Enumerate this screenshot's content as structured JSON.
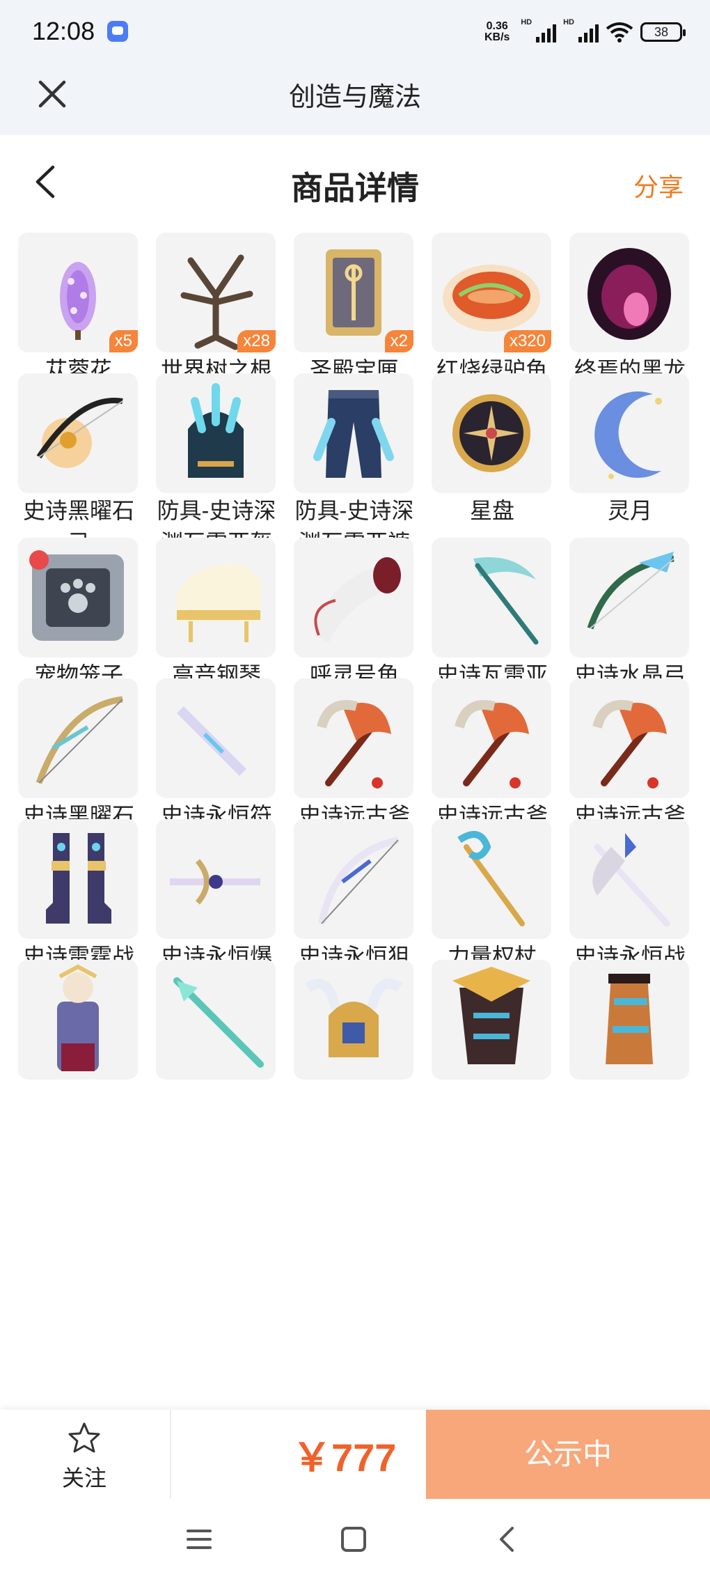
{
  "status": {
    "time": "12:08",
    "speed_top": "0.36",
    "speed_bottom": "KB/s",
    "battery": "38"
  },
  "app": {
    "title": "创造与魔法"
  },
  "header": {
    "title": "商品详情",
    "share": "分享"
  },
  "items": [
    {
      "name": "苁蓉花",
      "badge": "x5",
      "icon": "flower-cone-icon"
    },
    {
      "name": "世界树之根",
      "badge": "x28",
      "icon": "tree-root-icon"
    },
    {
      "name": "圣殿宝匣",
      "badge": "x2",
      "icon": "temple-box-icon"
    },
    {
      "name": "红烧绿驴鱼",
      "badge": "x320",
      "icon": "fish-dish-icon"
    },
    {
      "name": "终焉的黑龙蛋",
      "badge": "",
      "icon": "dragon-egg-icon"
    },
    {
      "name": "史诗黑曜石弓",
      "badge": "",
      "icon": "bow-icon"
    },
    {
      "name": "防具-史诗深渊瓦雷亚盔",
      "badge": "",
      "icon": "helmet-icon"
    },
    {
      "name": "防具-史诗深渊瓦雷亚裤",
      "badge": "",
      "icon": "pants-icon"
    },
    {
      "name": "星盘",
      "badge": "",
      "icon": "astrolabe-icon"
    },
    {
      "name": "灵月",
      "badge": "",
      "icon": "moon-icon"
    },
    {
      "name": "宠物笼子(满)",
      "badge": "",
      "icon": "pet-cage-icon"
    },
    {
      "name": "高音钢琴",
      "badge": "",
      "icon": "piano-icon"
    },
    {
      "name": "呼灵号角",
      "badge": "",
      "icon": "horn-icon"
    },
    {
      "name": "史诗瓦雷亚镰刀",
      "badge": "",
      "icon": "scythe-icon"
    },
    {
      "name": "史诗水晶弓",
      "badge": "",
      "icon": "crystal-bow-icon"
    },
    {
      "name": "史诗黑曜石狙击弓",
      "badge": "",
      "icon": "sniper-bow-icon"
    },
    {
      "name": "史诗永恒符文剑",
      "badge": "",
      "icon": "rune-sword-icon"
    },
    {
      "name": "史诗远古斧",
      "badge": "",
      "icon": "axe-icon"
    },
    {
      "name": "史诗远古斧",
      "badge": "",
      "icon": "axe-icon"
    },
    {
      "name": "史诗远古斧",
      "badge": "",
      "icon": "axe-icon"
    },
    {
      "name": "史诗雷霆战靴",
      "badge": "",
      "icon": "boots-icon"
    },
    {
      "name": "史诗永恒爆炸弩",
      "badge": "",
      "icon": "crossbow-icon"
    },
    {
      "name": "史诗永恒狙击弓",
      "badge": "",
      "icon": "eternal-bow-icon"
    },
    {
      "name": "力量权杖",
      "badge": "",
      "icon": "scepter-icon"
    },
    {
      "name": "史诗永恒战斧",
      "badge": "",
      "icon": "battle-axe-icon"
    },
    {
      "name": "",
      "badge": "",
      "icon": "armor-outfit-icon"
    },
    {
      "name": "",
      "badge": "",
      "icon": "spear-icon"
    },
    {
      "name": "",
      "badge": "",
      "icon": "winged-helmet-icon"
    },
    {
      "name": "",
      "badge": "",
      "icon": "pharaoh-armor-icon"
    },
    {
      "name": "",
      "badge": "",
      "icon": "bracer-icon"
    }
  ],
  "footer": {
    "follow": "关注",
    "price": "￥777",
    "status": "公示中"
  }
}
